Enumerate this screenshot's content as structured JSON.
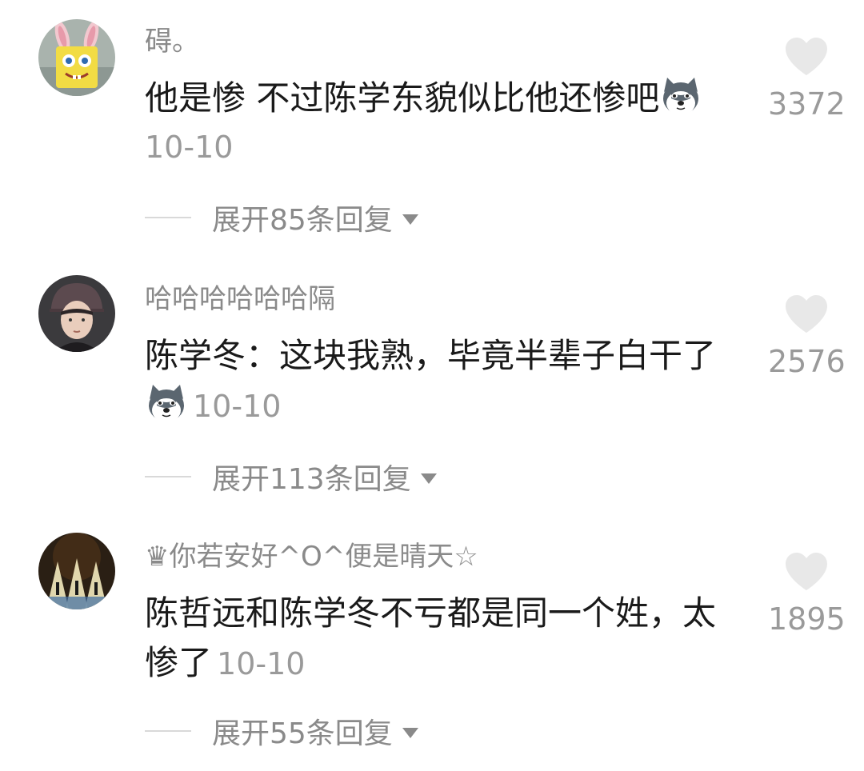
{
  "comments": [
    {
      "user": "碍。",
      "text": "他是惨 不过陈学东貌似比他还惨吧",
      "date": "10-10",
      "likes": "3372",
      "replies": "展开85条回复",
      "emoji": "husky-emoji-icon",
      "avatar": "spongebob-bunny-avatar"
    },
    {
      "user": "哈哈哈哈哈哈隔",
      "text": "陈学冬：这块我熟，毕竟半辈子白干了",
      "date": "10-10",
      "likes": "2576",
      "replies": "展开113条回复",
      "emoji": "husky-emoji-icon",
      "avatar": "young-man-avatar"
    },
    {
      "user": "♛你若安好^O^便是晴天☆",
      "text": "陈哲远和陈学冬不亏都是同一个姓，太惨了",
      "date": "10-10",
      "likes": "1895",
      "replies": "展开55条回复",
      "avatar": "stage-lights-avatar"
    }
  ],
  "colors": {
    "text": "#1a1a1a",
    "secondary": "#8a8a8a",
    "heart": "#e8e8e8"
  }
}
